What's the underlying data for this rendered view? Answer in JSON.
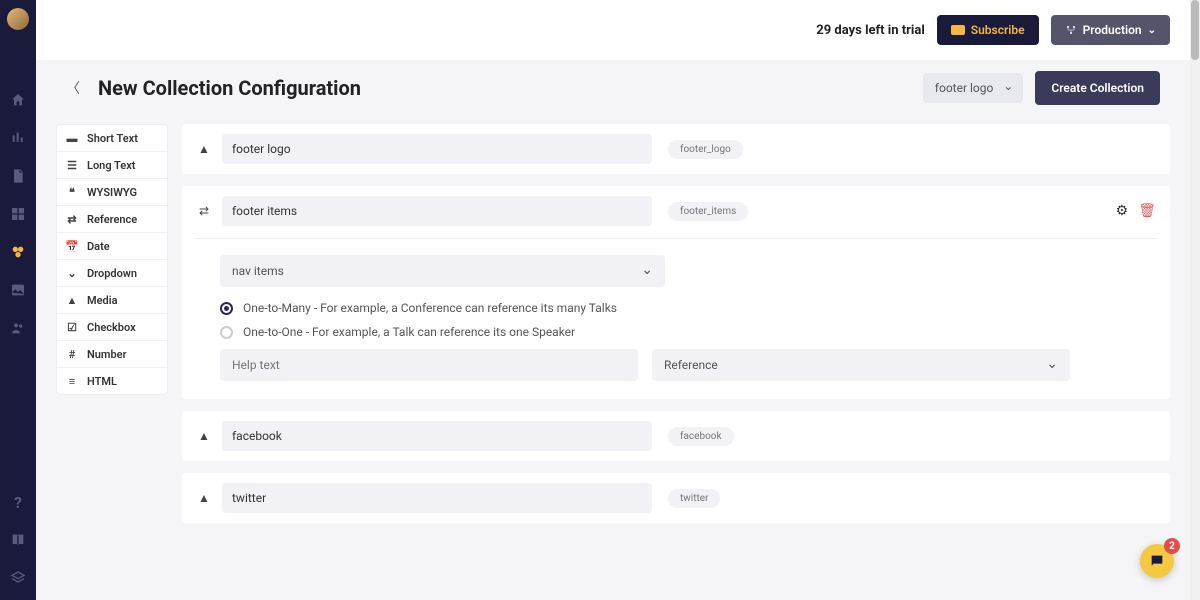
{
  "header": {
    "trial_text": "29 days left in trial",
    "subscribe_label": "Subscribe",
    "env_label": "Production"
  },
  "page": {
    "title": "New Collection Configuration",
    "display_field_select": "footer logo",
    "create_button": "Create Collection"
  },
  "field_types": [
    {
      "label": "Short Text",
      "icon": "short-text"
    },
    {
      "label": "Long Text",
      "icon": "long-text"
    },
    {
      "label": "WYSIWYG",
      "icon": "wysiwyg"
    },
    {
      "label": "Reference",
      "icon": "reference"
    },
    {
      "label": "Date",
      "icon": "date"
    },
    {
      "label": "Dropdown",
      "icon": "dropdown"
    },
    {
      "label": "Media",
      "icon": "media"
    },
    {
      "label": "Checkbox",
      "icon": "checkbox"
    },
    {
      "label": "Number",
      "icon": "number"
    },
    {
      "label": "HTML",
      "icon": "html"
    }
  ],
  "fields": [
    {
      "name": "footer logo",
      "slug": "footer_logo",
      "type_icon": "media"
    },
    {
      "name": "footer items",
      "slug": "footer_items",
      "type_icon": "reference",
      "expanded": true
    },
    {
      "name": "facebook",
      "slug": "facebook",
      "type_icon": "media"
    },
    {
      "name": "twitter",
      "slug": "twitter",
      "type_icon": "media"
    }
  ],
  "expanded": {
    "reference_collection": "nav items",
    "relation_options": [
      "One-to-Many - For example, a Conference can reference its many Talks",
      "One-to-One - For example, a Talk can reference its one Speaker"
    ],
    "help_placeholder": "Help text",
    "type_value": "Reference"
  },
  "chat": {
    "badge": "2"
  }
}
